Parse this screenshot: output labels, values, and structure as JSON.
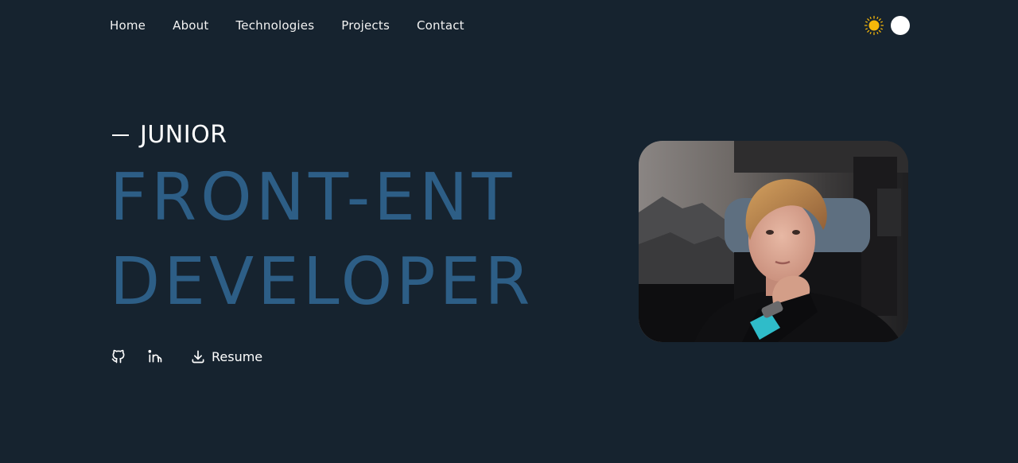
{
  "nav": {
    "items": [
      {
        "label": "Home"
      },
      {
        "label": "About"
      },
      {
        "label": "Technologies"
      },
      {
        "label": "Projects"
      },
      {
        "label": "Contact"
      }
    ]
  },
  "theme": {
    "sun_icon": "sun-icon",
    "toggle": "theme-toggle",
    "sun_color": "#f5b70a"
  },
  "hero": {
    "eyebrow": "JUNIOR",
    "title_line1": "FRONT-ENT",
    "title_line2": "DEVELOPER",
    "accent_color": "#2d5e86"
  },
  "social": {
    "github_icon": "github-icon",
    "linkedin_icon": "linkedin-icon",
    "resume_icon": "download-icon",
    "resume_label": "Resume"
  },
  "colors": {
    "background": "#16232f",
    "text": "#ffffff"
  }
}
